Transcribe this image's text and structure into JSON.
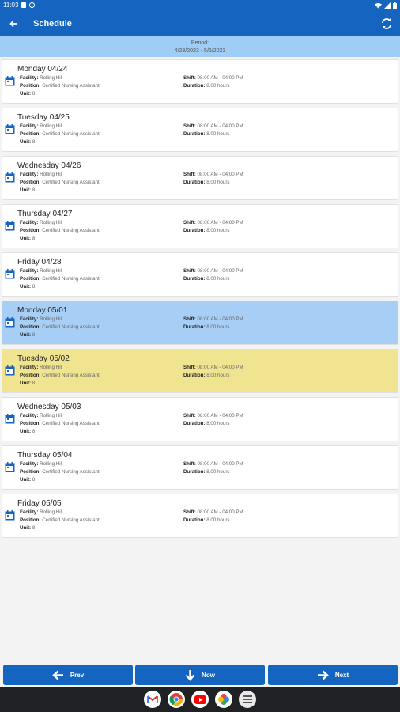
{
  "status_bar": {
    "time": "11:03"
  },
  "header": {
    "title": "Schedule"
  },
  "period": {
    "label": "Period:",
    "range": "4/23/2023 - 5/6/2023"
  },
  "labels": {
    "facility": "Facility:",
    "position": "Position:",
    "unit": "Unit:",
    "shift": "Shift:",
    "duration": "Duration:"
  },
  "days": [
    {
      "day": "Monday 04/24",
      "facility": "Rolling Hill",
      "position": "Certified Nursing Assistant",
      "unit": "8",
      "shift": "08:00 AM - 04:00 PM",
      "duration": "8.00 hours"
    },
    {
      "day": "Tuesday 04/25",
      "facility": "Rolling Hill",
      "position": "Certified Nursing Assistant",
      "unit": "8",
      "shift": "08:00 AM - 04:00 PM",
      "duration": "8.00 hours"
    },
    {
      "day": "Wednesday 04/26",
      "facility": "Rolling Hill",
      "position": "Certified Nursing Assistant",
      "unit": "8",
      "shift": "08:00 AM - 04:00 PM",
      "duration": "8.00 hours"
    },
    {
      "day": "Thursday 04/27",
      "facility": "Rolling Hill",
      "position": "Certified Nursing Assistant",
      "unit": "8",
      "shift": "08:00 AM - 04:00 PM",
      "duration": "8.00 hours"
    },
    {
      "day": "Friday 04/28",
      "facility": "Rolling Hill",
      "position": "Certified Nursing Assistant",
      "unit": "8",
      "shift": "08:00 AM - 04:00 PM",
      "duration": "8.00 hours"
    },
    {
      "day": "Monday 05/01",
      "facility": "Rolling Hill",
      "position": "Certified Nursing Assistant",
      "unit": "8",
      "shift": "08:00 AM - 04:00 PM",
      "duration": "8.00 hours"
    },
    {
      "day": "Tuesday 05/02",
      "facility": "Rolling Hill",
      "position": "Certified Nursing Assistant",
      "unit": "8",
      "shift": "08:00 AM - 04:00 PM",
      "duration": "8.00 hours"
    },
    {
      "day": "Wednesday 05/03",
      "facility": "Rolling Hill",
      "position": "Certified Nursing Assistant",
      "unit": "8",
      "shift": "08:00 AM - 04:00 PM",
      "duration": "8.00 hours"
    },
    {
      "day": "Thursday 05/04",
      "facility": "Rolling Hill",
      "position": "Certified Nursing Assistant",
      "unit": "8",
      "shift": "08:00 AM - 04:00 PM",
      "duration": "8.00 hours"
    },
    {
      "day": "Friday 05/05",
      "facility": "Rolling Hill",
      "position": "Certified Nursing Assistant",
      "unit": "8",
      "shift": "08:00 AM - 04:00 PM",
      "duration": "8.00 hours"
    }
  ],
  "selected_day": "Monday 05/01",
  "today": "Tuesday 05/02",
  "buttons": {
    "prev": "Prev",
    "now": "Now",
    "next": "Next"
  },
  "colors": {
    "primary": "#1565c0",
    "period_bg": "#9fcdf6",
    "selected_bg": "#a7cff5",
    "today_bg": "#f0e491"
  },
  "nav_apps": [
    "gmail-icon",
    "chrome-icon",
    "youtube-icon",
    "photos-icon",
    "app-drawer-icon"
  ]
}
